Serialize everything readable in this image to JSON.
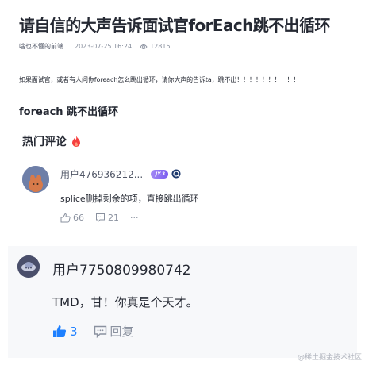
{
  "article": {
    "title": "请自信的大声告诉面试官forEach跳不出循环",
    "author": "啥也不懂的前端",
    "time": "2023-07-25 16:24",
    "views": "12815",
    "body": "如果面试官，或者有人问你foreach怎么跳出循环，请你大声的告诉ta，跳不出！！！！！！！！！！",
    "heading": "foreach 跳不出循环"
  },
  "comments_section": {
    "title": "热门评论"
  },
  "comment1": {
    "user": "用户476936212...",
    "badge": "JY.3",
    "text": "splice删掉剩余的项，直接跳出循环",
    "likes": "66",
    "replies": "21",
    "more": "···"
  },
  "comment2": {
    "user": "用户7750809980742",
    "text": "TMD，甘！你真是个天才。",
    "likes": "3",
    "reply_label": "回复"
  },
  "watermark": "@稀土掘金技术社区",
  "colors": {
    "accent": "#1e80ff",
    "hot": "#f53f3f",
    "muted": "#8a919f",
    "badge": "#7b5df0"
  }
}
